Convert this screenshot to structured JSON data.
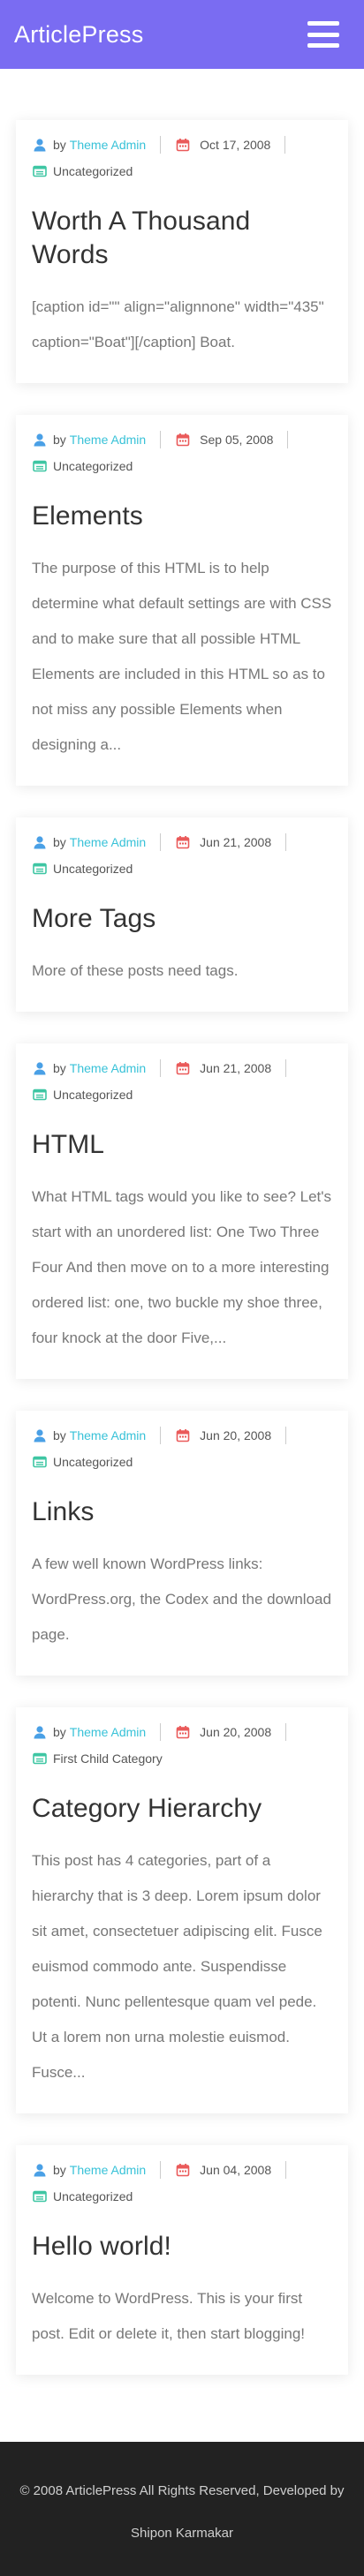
{
  "site": {
    "title": "ArticlePress"
  },
  "posts": [
    {
      "by": "by",
      "author": "Theme Admin",
      "date": "Oct 17, 2008",
      "category": "Uncategorized",
      "title": "Worth A Thousand Words",
      "excerpt": "[caption id=\"\" align=\"alignnone\" width=\"435\" caption=\"Boat\"][/caption] Boat."
    },
    {
      "by": "by",
      "author": "Theme Admin",
      "date": "Sep 05, 2008",
      "category": "Uncategorized",
      "title": "Elements",
      "excerpt": "The purpose of this HTML is to help determine what default settings are with CSS and to make sure that all possible HTML Elements are included in this HTML so as to not miss any possible Elements when designing a..."
    },
    {
      "by": "by",
      "author": "Theme Admin",
      "date": "Jun 21, 2008",
      "category": "Uncategorized",
      "title": "More Tags",
      "excerpt": "More of these posts need tags."
    },
    {
      "by": "by",
      "author": "Theme Admin",
      "date": "Jun 21, 2008",
      "category": "Uncategorized",
      "title": "HTML",
      "excerpt": "What HTML tags would you like to see? Let's start with an unordered list: One Two Three Four And then move on to a more interesting ordered list: one, two buckle my shoe three, four knock at the door Five,..."
    },
    {
      "by": "by",
      "author": "Theme Admin",
      "date": "Jun 20, 2008",
      "category": "Uncategorized",
      "title": "Links",
      "excerpt": "A few well known WordPress links: WordPress.org, the Codex and the download page."
    },
    {
      "by": "by",
      "author": "Theme Admin",
      "date": "Jun 20, 2008",
      "category": "First Child Category",
      "title": "Category Hierarchy",
      "excerpt": "This post has 4 categories, part of a hierarchy that is 3 deep. Lorem ipsum dolor sit amet, consectetuer adipiscing elit. Fusce euismod commodo ante. Suspendisse potenti. Nunc pellentesque quam vel pede. Ut a lorem non urna molestie euismod. Fusce..."
    },
    {
      "by": "by",
      "author": "Theme Admin",
      "date": "Jun 04, 2008",
      "category": "Uncategorized",
      "title": "Hello world!",
      "excerpt": "Welcome to WordPress. This is your first post. Edit or delete it, then start blogging!"
    }
  ],
  "footer": {
    "copyright": "© 2008 ArticlePress All Rights Reserved, Developed by",
    "developer": "Shipon Karmakar"
  },
  "icons": {
    "menu": "hamburger-menu-icon",
    "author": "user-icon",
    "date": "calendar-icon",
    "category": "folder-icon"
  },
  "colors": {
    "header": "#7a6cf2",
    "link": "#38c2d8",
    "author_icon": "#4aa0e6",
    "date_icon": "#ea5a5a",
    "category_icon": "#3ec6a3",
    "footer": "#222222"
  }
}
